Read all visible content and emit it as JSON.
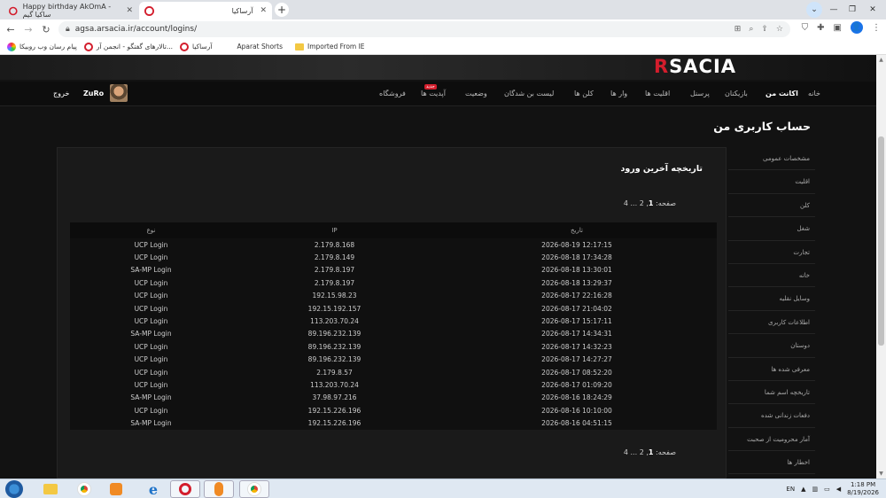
{
  "browser": {
    "tabs": [
      {
        "title": "Happy birthday AkOmA - ساکیا گیم"
      },
      {
        "title": "آرساکیا"
      }
    ],
    "url": "agsa.arsacia.ir/account/logins/",
    "bookmarks": [
      {
        "label": "پیام رسان وب روبیکا"
      },
      {
        "label": "تالارهای گفتگو - انجمن آر..."
      },
      {
        "label": "آرساکیا"
      },
      {
        "label": "Aparat Shorts"
      },
      {
        "label": "Imported From IE"
      }
    ],
    "profile_initial": "👤"
  },
  "site": {
    "logo_left": "R",
    "logo_right": "SACIA",
    "nav": [
      {
        "label": "خانه",
        "active": false
      },
      {
        "label": "اکانت من",
        "active": true
      },
      {
        "label": "بازیکنان",
        "active": false
      },
      {
        "label": "پرسنل",
        "active": false
      },
      {
        "label": "اقلیت ها",
        "active": false
      },
      {
        "label": "وار ها",
        "active": false
      },
      {
        "label": "کلن ها",
        "active": false
      },
      {
        "label": "لیست بن شدگان",
        "active": false
      },
      {
        "label": "وضعیت",
        "active": false
      },
      {
        "label": "آپدیت ها",
        "active": false,
        "badge": "جدید"
      },
      {
        "label": "فروشگاه",
        "active": false
      }
    ],
    "user": {
      "name": "ZuRo",
      "logout": "خروج"
    }
  },
  "page": {
    "title": "حساب کاربری من",
    "sidebar": [
      "مشخصات عمومی",
      "اقلیت",
      "کلن",
      "شغل",
      "تجارت",
      "خانه",
      "وسایل نقلیه",
      "اطلاعات کاربری",
      "دوستان",
      "معرفی شده ها",
      "تاریخچه اسم شما",
      "دفعات زندانی شده",
      "آمار محرومیت از صحبت",
      "اخطار ها"
    ],
    "panel_title": "تاریخچه آخرین ورود",
    "pager": {
      "label": "صفحه:",
      "current": "1",
      "rest": ", 2 ... 4"
    },
    "columns": {
      "date": "تاریخ",
      "ip": "IP",
      "type": "نوع"
    },
    "rows": [
      {
        "date": "2026-08-19 12:17:15",
        "ip": "2.179.8.168",
        "type": "UCP Login"
      },
      {
        "date": "2026-08-18 17:34:28",
        "ip": "2.179.8.149",
        "type": "UCP Login"
      },
      {
        "date": "2026-08-18 13:30:01",
        "ip": "2.179.8.197",
        "type": "SA-MP Login"
      },
      {
        "date": "2026-08-18 13:29:37",
        "ip": "2.179.8.197",
        "type": "UCP Login"
      },
      {
        "date": "2026-08-17 22:16:28",
        "ip": "192.15.98.23",
        "type": "UCP Login"
      },
      {
        "date": "2026-08-17 21:04:02",
        "ip": "192.15.192.157",
        "type": "UCP Login"
      },
      {
        "date": "2026-08-17 15:17:11",
        "ip": "113.203.70.24",
        "type": "UCP Login"
      },
      {
        "date": "2026-08-17 14:34:31",
        "ip": "89.196.232.139",
        "type": "SA-MP Login"
      },
      {
        "date": "2026-08-17 14:32:23",
        "ip": "89.196.232.139",
        "type": "UCP Login"
      },
      {
        "date": "2026-08-17 14:27:27",
        "ip": "89.196.232.139",
        "type": "UCP Login"
      },
      {
        "date": "2026-08-17 08:52:20",
        "ip": "2.179.8.57",
        "type": "UCP Login"
      },
      {
        "date": "2026-08-17 01:09:20",
        "ip": "113.203.70.24",
        "type": "UCP Login"
      },
      {
        "date": "2026-08-16 18:24:29",
        "ip": "37.98.97.216",
        "type": "SA-MP Login"
      },
      {
        "date": "2026-08-16 10:10:00",
        "ip": "192.15.226.196",
        "type": "UCP Login"
      },
      {
        "date": "2026-08-16 04:51:15",
        "ip": "192.15.226.196",
        "type": "SA-MP Login"
      }
    ]
  },
  "taskbar": {
    "lang": "EN",
    "time": "1:18 PM",
    "date": "8/19/2026"
  },
  "colors": {
    "accent": "#d31d2c",
    "background": "#121212",
    "panel": "#1a1a1a"
  }
}
